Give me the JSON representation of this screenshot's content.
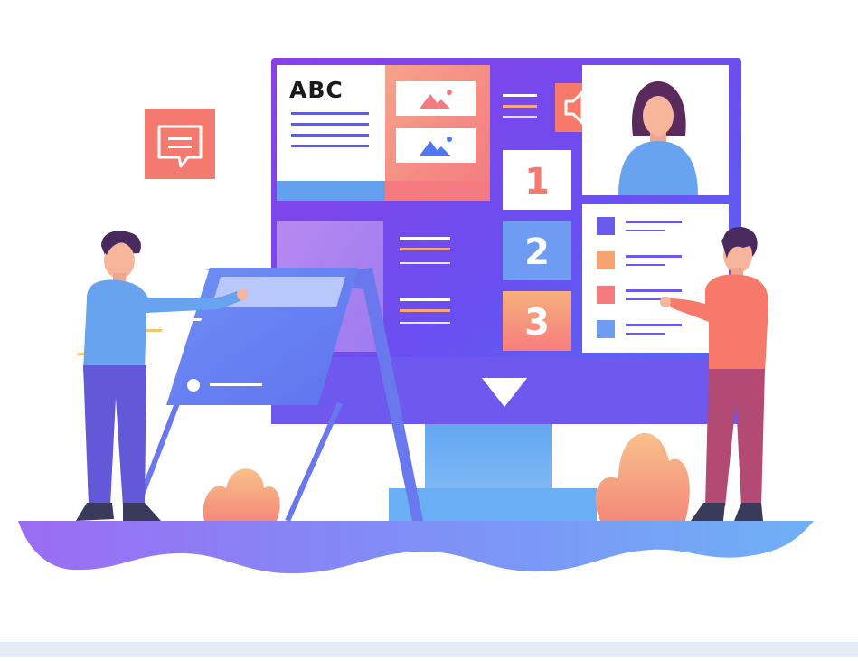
{
  "illustration": {
    "book_heading": "ABC",
    "steps": [
      {
        "label": "1"
      },
      {
        "label": "2"
      },
      {
        "label": "3"
      }
    ]
  },
  "colors": {
    "monitor_top": "#7b3fe4",
    "monitor_bottom": "#4a6cf7",
    "coral": "#f7796a",
    "light_blue": "#67a3ef",
    "stand_blue": "#5aa3f0",
    "footer_strip": "#e4ecf5"
  },
  "icons": [
    "chat-icon",
    "speaker-icon",
    "image-icon",
    "triangle-down-icon"
  ]
}
